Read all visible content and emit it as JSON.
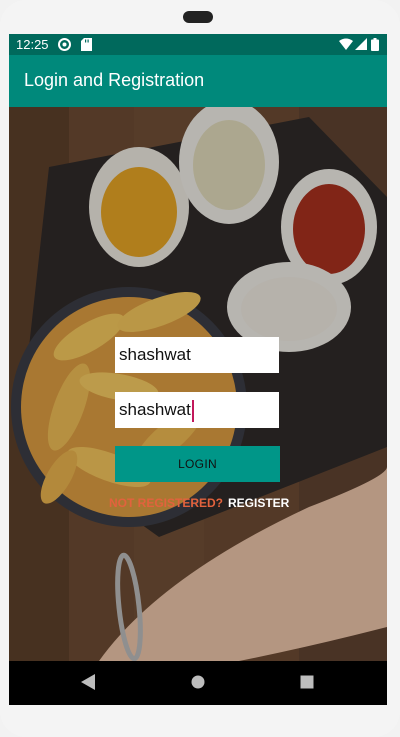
{
  "status_bar": {
    "time": "12:25",
    "icons": [
      "sync-icon",
      "sd-card-icon",
      "wifi-icon",
      "signal-icon",
      "battery-icon"
    ]
  },
  "app_bar": {
    "title": "Login and Registration",
    "color": "#00897b"
  },
  "form": {
    "username_value": "shashwat",
    "password_value": "shashwat",
    "login_label": "LOGIN",
    "not_registered_label": "NOT REGISTERED?",
    "register_label": "REGISTER"
  },
  "navigation": {
    "icons": [
      "back-icon",
      "home-icon",
      "recents-icon"
    ]
  },
  "colors": {
    "status_bar": "#00695c",
    "button": "#009688",
    "not_registered": "#e2623d",
    "cursor": "#c2185b"
  }
}
